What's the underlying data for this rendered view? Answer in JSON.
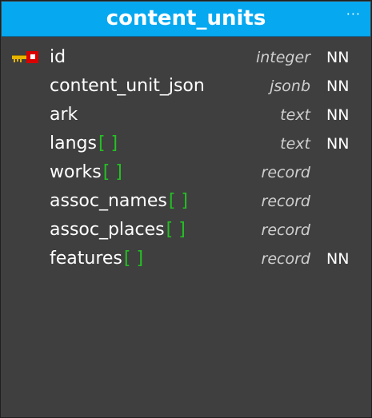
{
  "table": {
    "title": "content_units",
    "menu_icon": "ellipsis-icon",
    "menu_glyph": "···",
    "columns": [
      {
        "name": "id",
        "type": "integer",
        "nn": "NN",
        "array_mark": "",
        "primary_key": true
      },
      {
        "name": "content_unit_json",
        "type": "jsonb",
        "nn": "NN",
        "array_mark": "",
        "primary_key": false
      },
      {
        "name": "ark",
        "type": "text",
        "nn": "NN",
        "array_mark": "",
        "primary_key": false
      },
      {
        "name": "langs",
        "type": "text",
        "nn": "NN",
        "array_mark": "[ ]",
        "primary_key": false
      },
      {
        "name": "works",
        "type": "record",
        "nn": "",
        "array_mark": "[ ]",
        "primary_key": false
      },
      {
        "name": "assoc_names",
        "type": "record",
        "nn": "",
        "array_mark": "[ ]",
        "primary_key": false
      },
      {
        "name": "assoc_places",
        "type": "record",
        "nn": "",
        "array_mark": "[ ]",
        "primary_key": false
      },
      {
        "name": "features",
        "type": "record",
        "nn": "NN",
        "array_mark": "[ ]",
        "primary_key": false
      }
    ]
  },
  "colors": {
    "header": "#06a8f0",
    "body": "#3f3f3f",
    "array_mark": "#24c024",
    "key_gold": "#e8b400",
    "key_red": "#d90000"
  }
}
